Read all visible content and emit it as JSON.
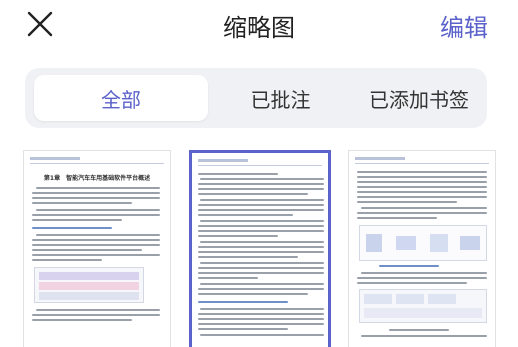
{
  "header": {
    "title": "缩略图",
    "edit_label": "编辑"
  },
  "tabs": [
    {
      "label": "全部",
      "active": true
    },
    {
      "label": "已批注",
      "active": false
    },
    {
      "label": "已添加书签",
      "active": false
    }
  ],
  "thumbnails": [
    {
      "chapter_title": "第1章　智能汽车车用基础软件平台概述",
      "selected": false
    },
    {
      "chapter_title": "",
      "selected": true
    },
    {
      "chapter_title": "",
      "selected": false
    }
  ],
  "colors": {
    "accent": "#5b62c9",
    "tab_bg": "#f0f1f4"
  }
}
